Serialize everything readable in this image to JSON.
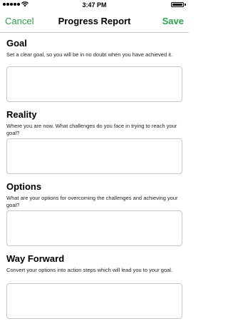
{
  "status": {
    "time": "3:47 PM"
  },
  "nav": {
    "cancel_label": "Cancel",
    "title": "Progress Report",
    "save_label": "Save"
  },
  "sections": [
    {
      "title": "Goal",
      "description": "Set a clear goal, so you will be in no doubt when you have achieved it.",
      "value": ""
    },
    {
      "title": "Reality",
      "description": "Where you are now. What challenges do you face in trying to reach your goal?",
      "value": ""
    },
    {
      "title": "Options",
      "description": "What are your options for overcoming the challenges and achieving your goal?",
      "value": ""
    },
    {
      "title": "Way Forward",
      "description": "Convert your options into action steps which will lead you to your goal.",
      "value": ""
    }
  ],
  "colors": {
    "accent": "#2e9e4f",
    "border": "#c7c7cc"
  }
}
